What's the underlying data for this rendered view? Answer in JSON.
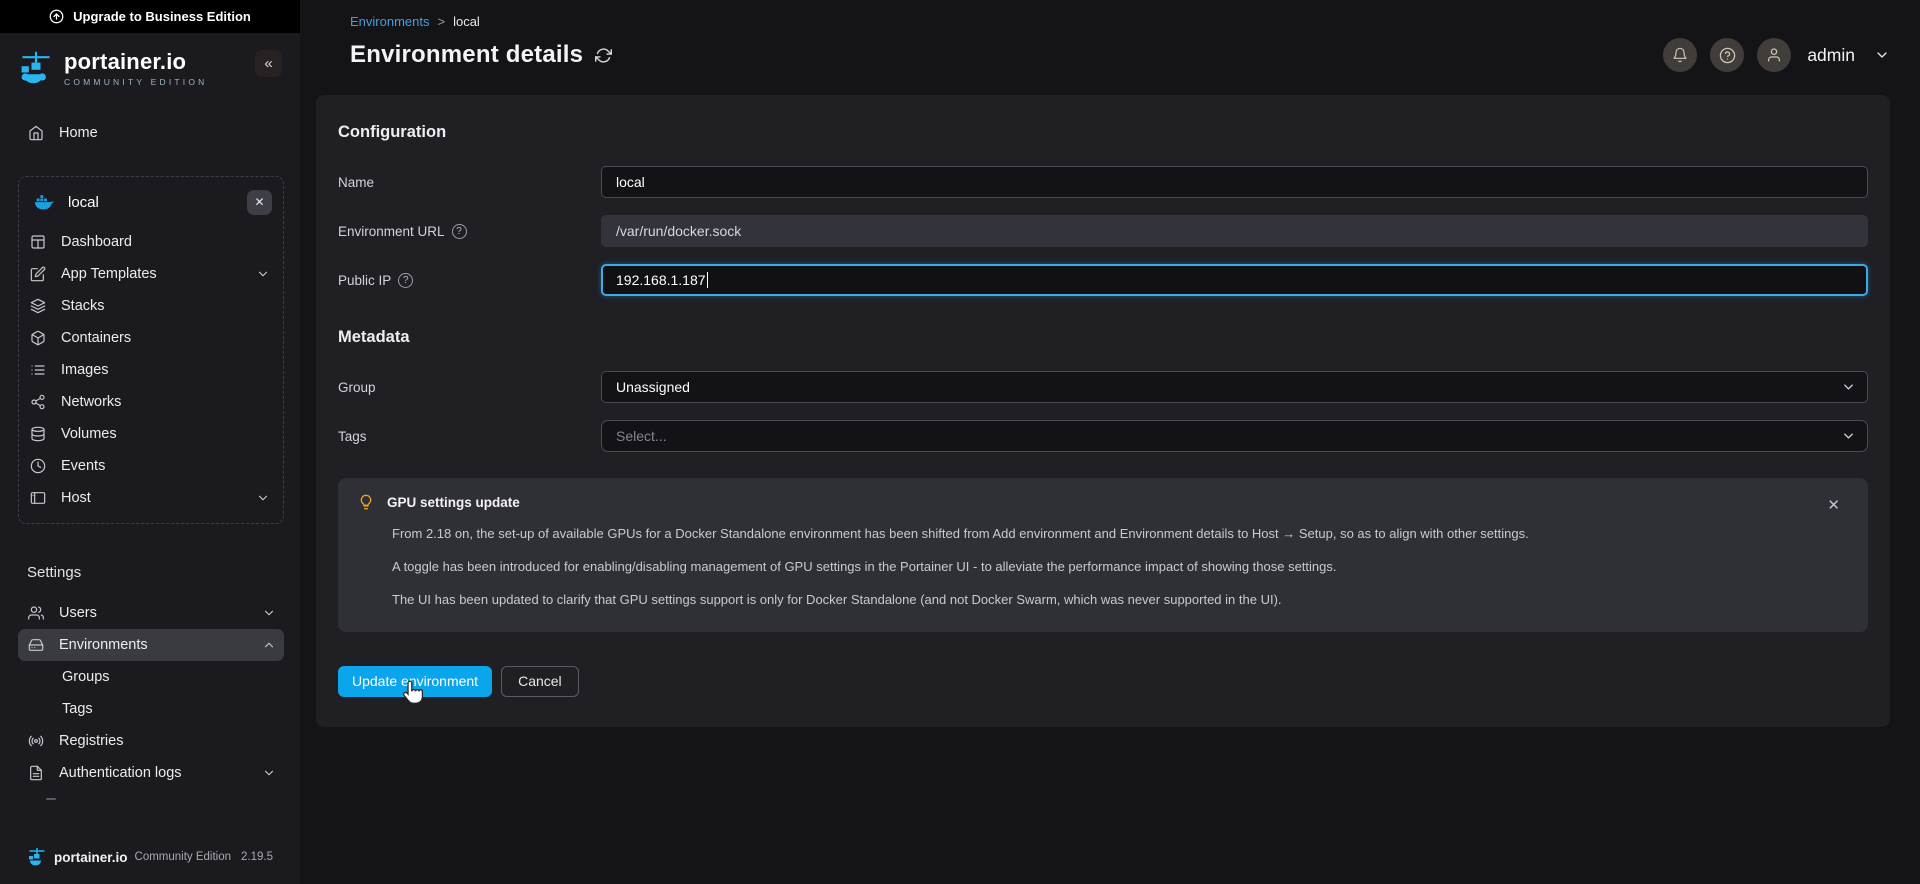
{
  "colors": {
    "accent": "#0ba5ec",
    "link": "#479fd9",
    "focus_border": "#41a8e0",
    "bulb": "#f0a325",
    "docker_blue": "#1d9fe0",
    "logo_blue": "#29b6f0"
  },
  "icons": {
    "collapse": "«",
    "close": "✕",
    "help": "?",
    "breadcrumb_sep": ">"
  },
  "banner": {
    "label": "Upgrade to Business Edition"
  },
  "sidebar": {
    "brand": "portainer.io",
    "edition": "COMMUNITY EDITION",
    "home_label": "Home",
    "env_name": "local",
    "env_items": [
      {
        "label": "Dashboard"
      },
      {
        "label": "App Templates"
      },
      {
        "label": "Stacks"
      },
      {
        "label": "Containers"
      },
      {
        "label": "Images"
      },
      {
        "label": "Networks"
      },
      {
        "label": "Volumes"
      },
      {
        "label": "Events"
      },
      {
        "label": "Host"
      }
    ],
    "settings_header": "Settings",
    "users_label": "Users",
    "environments_label": "Environments",
    "groups_label": "Groups",
    "tags_label": "Tags",
    "registries_label": "Registries",
    "authlogs_label": "Authentication logs",
    "footer": {
      "brand": "portainer.io",
      "edition": "Community Edition",
      "version": "2.19.5"
    }
  },
  "header": {
    "breadcrumb_root": "Environments",
    "breadcrumb_current": "local",
    "title": "Environment details",
    "user_name": "admin"
  },
  "config": {
    "heading": "Configuration",
    "name_label": "Name",
    "name_value": "local",
    "url_label": "Environment URL",
    "url_value": "/var/run/docker.sock",
    "ip_label": "Public IP",
    "ip_value": "192.168.1.187"
  },
  "metadata": {
    "heading": "Metadata",
    "group_label": "Group",
    "group_value": "Unassigned",
    "tags_label": "Tags",
    "tags_placeholder": "Select..."
  },
  "notice": {
    "title": "GPU settings update",
    "p1": "From 2.18 on, the set-up of available GPUs for a Docker Standalone environment has been shifted from Add environment and Environment details to Host → Setup, so as to align with other settings.",
    "p2": "A toggle has been introduced for enabling/disabling management of GPU settings in the Portainer UI - to alleviate the performance impact of showing those settings.",
    "p3": "The UI has been updated to clarify that GPU settings support is only for Docker Standalone (and not Docker Swarm, which was never supported in the UI)."
  },
  "actions": {
    "update_label": "Update environment",
    "cancel_label": "Cancel"
  }
}
